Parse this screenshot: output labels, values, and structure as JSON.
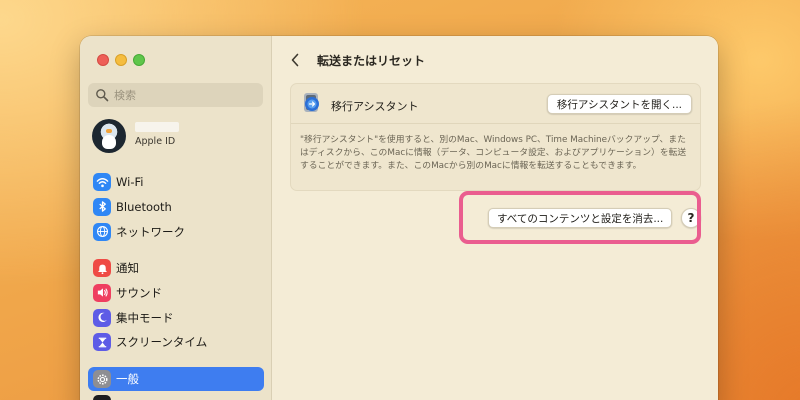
{
  "window": {
    "title": "転送またはリセット"
  },
  "sidebar": {
    "search_placeholder": "検索",
    "account": {
      "name": "",
      "subtitle": "Apple ID"
    },
    "groups": [
      [
        {
          "label": "Wi-Fi",
          "icon": "wifi-icon",
          "color": "#2f87f5"
        },
        {
          "label": "Bluetooth",
          "icon": "bluetooth-icon",
          "color": "#2f87f5"
        },
        {
          "label": "ネットワーク",
          "icon": "globe-icon",
          "color": "#2f87f5"
        }
      ],
      [
        {
          "label": "通知",
          "icon": "bell-icon",
          "color": "#ef4b45"
        },
        {
          "label": "サウンド",
          "icon": "speaker-icon",
          "color": "#ef3f60"
        },
        {
          "label": "集中モード",
          "icon": "moon-icon",
          "color": "#5e5ce6"
        },
        {
          "label": "スクリーンタイム",
          "icon": "hourglass-icon",
          "color": "#5e5ce6"
        }
      ],
      [
        {
          "label": "一般",
          "icon": "gear-icon",
          "color": "#8e8e93",
          "selected": true
        }
      ]
    ]
  },
  "migration": {
    "title": "移行アシスタント",
    "open_button": "移行アシスタントを開く...",
    "description": "\"移行アシスタント\"を使用すると、別のMac、Windows PC、Time Machineバックアップ、またはディスクから、このMacに情報（データ、コンピュータ設定、およびアプリケーション）を転送することができます。また、このMacから別のMacに情報を転送することもできます。"
  },
  "erase": {
    "button": "すべてのコンテンツと設定を消去...",
    "help": "?"
  },
  "colors": {
    "accent": "#3e7df0",
    "highlight": "#ea5d8f"
  }
}
